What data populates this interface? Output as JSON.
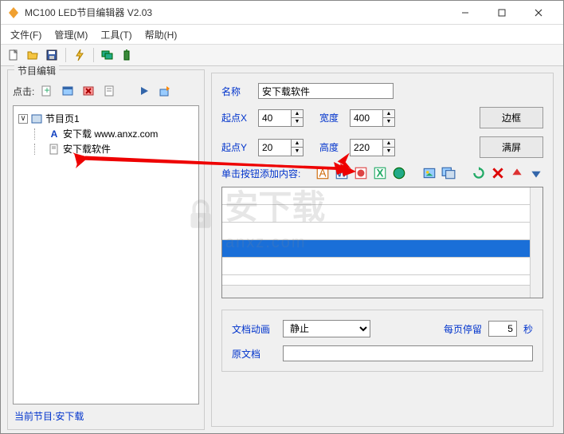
{
  "window": {
    "title": "MC100 LED节目编辑器 V2.03"
  },
  "menu": {
    "file": "文件(F)",
    "manage": "管理(M)",
    "tools": "工具(T)",
    "help": "帮助(H)"
  },
  "left": {
    "group_label": "节目编辑",
    "click_label": "点击:",
    "tree": {
      "root": "节目页1",
      "child1": "安下载 www.anxz.com",
      "child2": "安下载软件"
    },
    "status_label": "当前节目:",
    "status_value": "安下载"
  },
  "right": {
    "name_label": "名称",
    "name_value": "安下载软件",
    "startx_label": "起点X",
    "startx_value": "40",
    "width_label": "宽度",
    "width_value": "400",
    "starty_label": "起点Y",
    "starty_value": "20",
    "height_label": "高度",
    "height_value": "220",
    "border_btn": "边框",
    "full_btn": "满屏",
    "add_content_label": "单击按钮添加内容:",
    "doc_anim_label": "文档动画",
    "doc_anim_value": "静止",
    "stay_label": "每页停留",
    "stay_value": "5",
    "stay_unit": "秒",
    "orig_doc_label": "原文档"
  },
  "watermark": {
    "text": "安下载",
    "sub": "anxz.com"
  }
}
